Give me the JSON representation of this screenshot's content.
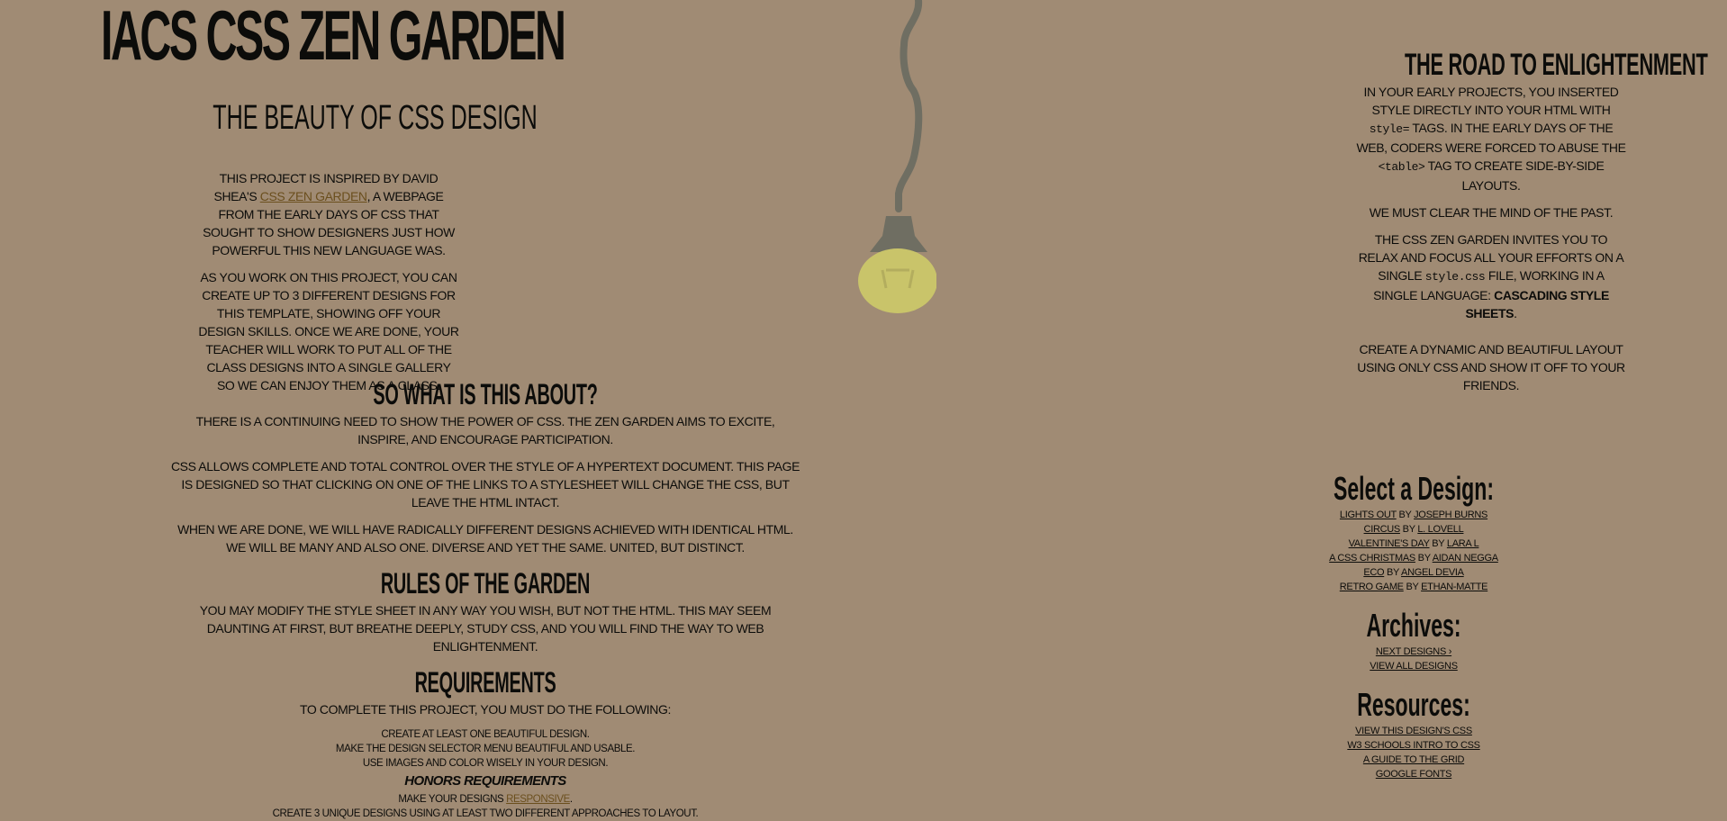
{
  "header": {
    "title": "IACS CSS Zen Garden",
    "tagline": "The Beauty of CSS Design"
  },
  "preamble": {
    "p1_pre": "This project is inspired by David Shea's ",
    "p1_link": "CSS Zen Garden",
    "p1_post": ", a webpage from the early days of CSS that sought to show designers just how powerful this new language was.",
    "p2": "As you work on this project, you can create up to 3 different designs for this template, showing off your design skills. Once we are done, your teacher will work to put all of the class designs into a single gallery so we can enjoy them as a class."
  },
  "about": {
    "heading": "So What is This About?",
    "p1": "There is a continuing need to show the power of CSS. The Zen Garden aims to excite, inspire, and encourage participation.",
    "p2": "CSS allows complete and total control over the style of a hypertext document. This page is designed so that clicking on one of the links to a stylesheet will change the CSS, but leave the HTML intact.",
    "p3": "When we are done, we will have radically different designs achieved with identical HTML. We will be many and also one. Diverse and yet the same. United, but distinct."
  },
  "rules": {
    "heading": "Rules of the Garden",
    "p1": "You may modify the style sheet in any way you wish, but not the HTML. This may seem daunting at first, but breathe deeply, study CSS, and you will find the way to web enlightenment."
  },
  "requirements": {
    "heading": "Requirements",
    "intro": "To complete this project, you must do the following:",
    "items": [
      "Create at least one beautiful design.",
      "Make the design selector menu beautiful and usable.",
      "Use images and color wisely in your design."
    ],
    "honors_heading": "Honors Requirements",
    "honors_item1_pre": "Make your designs ",
    "honors_item1_link": "responsive",
    "honors_item1_post": ".",
    "honors_item2": "Create 3 unique designs using at least two different approaches to layout."
  },
  "road": {
    "heading": "The Road to Enlightenment",
    "p1_a": "In your early projects, you inserted style directly into your HTML with ",
    "p1_code1": "style=",
    "p1_b": " tags. In the early days of the web, coders were forced to abuse the ",
    "p1_code2": "<table>",
    "p1_c": " tag to create side-by-side layouts.",
    "p2": "We must clear the mind of the past.",
    "p3_a": "The CSS Zen Garden invites you to relax and focus all your efforts on a single ",
    "p3_code": "style.css",
    "p3_b": " file, working in a single language: ",
    "p3_strong": "Cascading Style Sheets",
    "p3_c": ".",
    "p4": "Create a dynamic and beautiful layout using only CSS and show it off to your friends."
  },
  "sidebar": {
    "select_heading": "Select a Design:",
    "designs": [
      {
        "name": "Lights Out",
        "by": " by ",
        "author": "Joseph Burns"
      },
      {
        "name": "Circus",
        "by": " by ",
        "author": "L. Lovell"
      },
      {
        "name": "Valentine's Day",
        "by": " by ",
        "author": "Lara L"
      },
      {
        "name": "A CSS Christmas",
        "by": " by ",
        "author": "Aidan Negga"
      },
      {
        "name": "ECO",
        "by": " by ",
        "author": "Angel Devia"
      },
      {
        "name": "Retro Game",
        "by": " by ",
        "author": "Ethan-Matte"
      }
    ],
    "archives_heading": "Archives:",
    "archives": [
      "Next Designs ›",
      "View All Designs"
    ],
    "resources_heading": "Resources:",
    "resources": [
      "View This Design's CSS",
      "W3 Schools Intro to CSS",
      "A Guide to the Grid",
      "Google Fonts"
    ]
  },
  "colors": {
    "background": "#a08b74",
    "text": "#0c0c0a",
    "link": "#6b4f1e",
    "lamp_cord": "#6f6e62",
    "lamp_bulb": "#c9c46a"
  },
  "icons": {
    "lamp": "hanging-lamp-icon"
  }
}
